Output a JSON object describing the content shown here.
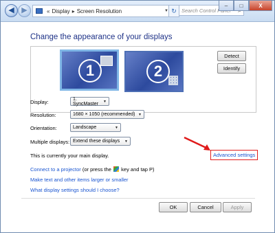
{
  "titlebar": {
    "breadcrumb": [
      "Display",
      "Screen Resolution"
    ],
    "search_placeholder": "Search Control Panel",
    "icons": [
      "back-icon",
      "forward-icon",
      "refresh-icon",
      "search-icon"
    ]
  },
  "window_buttons": {
    "minimize": "–",
    "maximize": "□",
    "close": "X"
  },
  "main": {
    "heading": "Change the appearance of your displays",
    "monitors": [
      {
        "number": "1",
        "selected": true
      },
      {
        "number": "2",
        "selected": false
      }
    ],
    "detect_label": "Detect",
    "identify_label": "Identify"
  },
  "settings": {
    "display_label": "Display:",
    "display_value": "1. SyncMaster",
    "resolution_label": "Resolution:",
    "resolution_value": "1680 × 1050 (recommended)",
    "orientation_label": "Orientation:",
    "orientation_value": "Landscape",
    "multiple_label": "Multiple displays:",
    "multiple_value": "Extend these displays"
  },
  "status_text": "This is currently your main display.",
  "advanced_settings": "Advanced settings",
  "links": {
    "projector_link": "Connect to a projector",
    "projector_rest_a": " (or press the ",
    "projector_rest_b": " key and tap P)",
    "text_size_link": "Make text and other items larger or smaller",
    "help_link": "What display settings should I choose?"
  },
  "buttons": {
    "ok": "OK",
    "cancel": "Cancel",
    "apply": "Apply"
  },
  "colors": {
    "heading": "#1e3287",
    "link": "#1a55d0",
    "highlight": "#e01b1b"
  }
}
